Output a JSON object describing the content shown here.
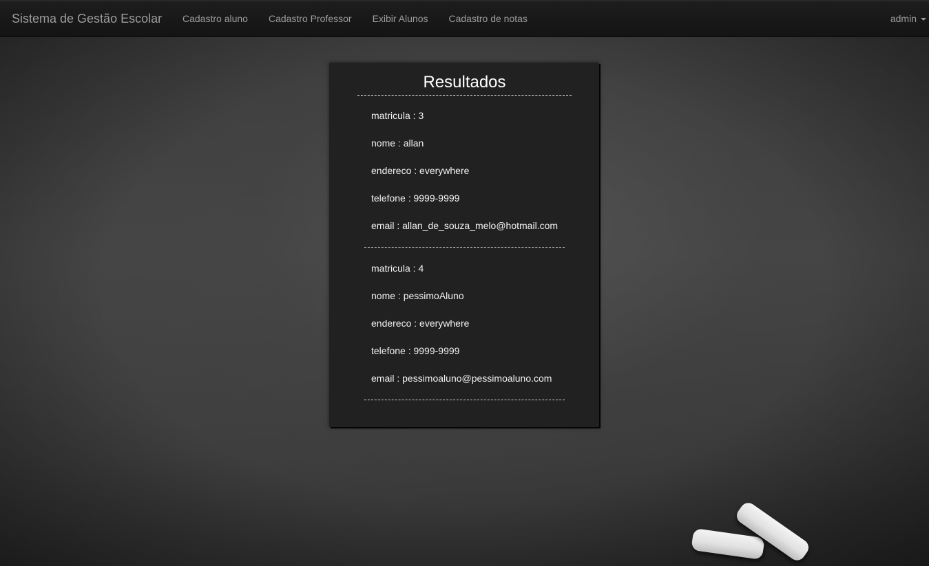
{
  "navbar": {
    "brand": "Sistema de Gestão Escolar",
    "links": [
      {
        "label": "Cadastro aluno"
      },
      {
        "label": "Cadastro Professor"
      },
      {
        "label": "Exibir Alunos"
      },
      {
        "label": "Cadastro de notas"
      }
    ],
    "user": "admin"
  },
  "results": {
    "title": "Resultados",
    "records": [
      {
        "matricula": "matricula : 3",
        "nome": "nome : allan",
        "endereco": "endereco : everywhere",
        "telefone": "telefone : 9999-9999",
        "email": "email : allan_de_souza_melo@hotmail.com"
      },
      {
        "matricula": "matricula : 4",
        "nome": "nome : pessimoAluno",
        "endereco": "endereco : everywhere",
        "telefone": "telefone : 9999-9999",
        "email": "email : pessimoaluno@pessimoaluno.com"
      }
    ]
  },
  "colors": {
    "navbar_bg": "#181818",
    "nav_text": "#9d9d9d",
    "panel_bg": "#212121",
    "panel_text": "#ffffff"
  }
}
